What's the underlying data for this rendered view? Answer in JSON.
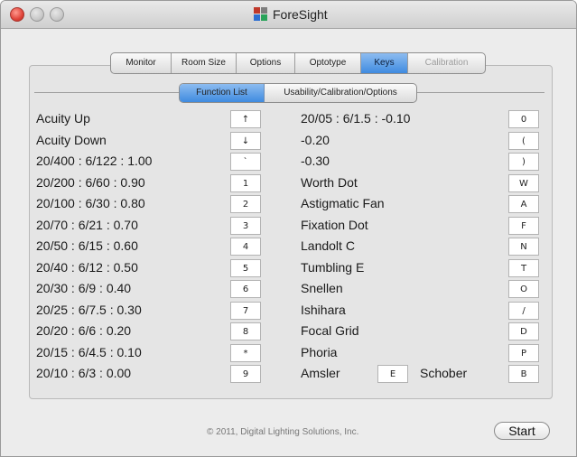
{
  "window": {
    "title": "ForeSight"
  },
  "tabs": [
    "Monitor",
    "Room Size",
    "Options",
    "Optotype",
    "Keys",
    "Calibration"
  ],
  "subtabs": [
    "Function List",
    "Usability/Calibration/Options"
  ],
  "left_rows": [
    {
      "label": "Acuity Up",
      "key": "↑"
    },
    {
      "label": "Acuity Down",
      "key": "↓"
    },
    {
      "label": "20/400 : 6/122 : 1.00",
      "key": "`"
    },
    {
      "label": "20/200 : 6/60 : 0.90",
      "key": "1"
    },
    {
      "label": "20/100 : 6/30 : 0.80",
      "key": "2"
    },
    {
      "label": "20/70 : 6/21 : 0.70",
      "key": "3"
    },
    {
      "label": "20/50 : 6/15 : 0.60",
      "key": "4"
    },
    {
      "label": "20/40 : 6/12 : 0.50",
      "key": "5"
    },
    {
      "label": "20/30 : 6/9 : 0.40",
      "key": "6"
    },
    {
      "label": "20/25 : 6/7.5 : 0.30",
      "key": "7"
    },
    {
      "label": "20/20 : 6/6 : 0.20",
      "key": "8"
    },
    {
      "label": "20/15 : 6/4.5 : 0.10",
      "key": "*"
    },
    {
      "label": "20/10 : 6/3 : 0.00",
      "key": "9"
    }
  ],
  "right_rows": [
    {
      "label": "20/05 : 6/1.5 : -0.10",
      "key": "0"
    },
    {
      "label": "-0.20",
      "key": "("
    },
    {
      "label": "-0.30",
      "key": ")"
    },
    {
      "label": "Worth Dot",
      "key": "W"
    },
    {
      "label": "Astigmatic Fan",
      "key": "A"
    },
    {
      "label": "Fixation Dot",
      "key": "F"
    },
    {
      "label": "Landolt C",
      "key": "N"
    },
    {
      "label": "Tumbling E",
      "key": "T"
    },
    {
      "label": "Snellen",
      "key": "O"
    },
    {
      "label": "Ishihara",
      "key": "/"
    },
    {
      "label": "Focal Grid",
      "key": "D"
    },
    {
      "label": "Phoria",
      "key": "P"
    },
    {
      "label": "Amsler",
      "key": "E",
      "extra_label": "Schober",
      "extra_key": "B"
    }
  ],
  "footer": {
    "copyright": "© 2011, Digital Lighting Solutions, Inc.",
    "start": "Start"
  },
  "colors": {
    "selected_tab": "#4a90e2",
    "window_bg": "#ececec",
    "group_bg": "#e5e5e5"
  }
}
